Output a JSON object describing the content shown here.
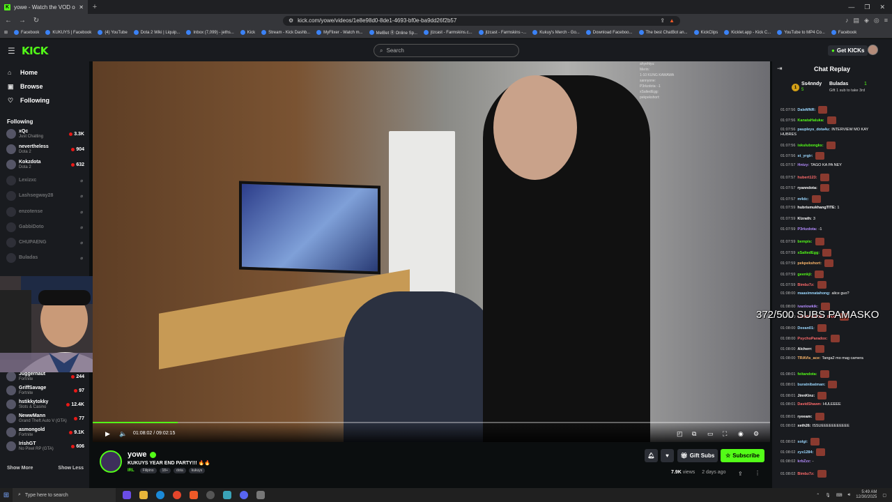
{
  "browser": {
    "tab_title": "yowe - Watch the VOD on Kick",
    "url": "kick.com/yowe/videos/1e8e98d0-8de1-4693-bf0e-ba9dd26f2b57",
    "bookmarks": [
      "Facebook",
      "KUKUYS | Facebook",
      "(4) YouTube",
      "Dota 2 Wiki | Liquip...",
      "Inbox (7,099) - jeths...",
      "Kick",
      "Stream - Kick Dashb...",
      "MyFlixer - Watch m...",
      "MelBet Ⓡ Online Sp...",
      "jtzcast - Farmskins.c...",
      "jtzcast - Farmskins -...",
      "Kukuy's Merch - Go...",
      "Download Faceboo...",
      "The best ChatBot an...",
      "KickClips",
      "Kicklet.app - Kick C...",
      "YouTube to MP4 Co...",
      "Facebook"
    ]
  },
  "header": {
    "logo": "KICK",
    "search_placeholder": "Search",
    "get_kicks": "Get KICKs"
  },
  "sidebar": {
    "nav": [
      {
        "label": "Home",
        "icon": "home-icon"
      },
      {
        "label": "Browse",
        "icon": "browse-icon"
      },
      {
        "label": "Following",
        "icon": "heart-icon"
      }
    ],
    "following_heading": "Following",
    "channels": [
      {
        "name": "xQc",
        "category": "Just Chatting",
        "viewers": "3.3K",
        "live": true
      },
      {
        "name": "nevertheless",
        "category": "Dota 2",
        "viewers": "904",
        "live": true
      },
      {
        "name": "Kokzdota",
        "category": "Dota 2",
        "viewers": "632",
        "live": true
      },
      {
        "name": "Lexizxc",
        "category": "",
        "viewers": "",
        "live": false
      },
      {
        "name": "Lashsegway28",
        "category": "",
        "viewers": "",
        "live": false
      },
      {
        "name": "enzotense",
        "category": "",
        "viewers": "",
        "live": false
      },
      {
        "name": "GabbiDoto",
        "category": "",
        "viewers": "",
        "live": false
      },
      {
        "name": "CHUPAENG",
        "category": "",
        "viewers": "",
        "live": false
      },
      {
        "name": "Buladas",
        "category": "",
        "viewers": "",
        "live": false
      },
      {
        "name": "Juggernaut",
        "category": "Fortnite",
        "viewers": "244",
        "live": true
      },
      {
        "name": "GriffSavage",
        "category": "Fortnite",
        "viewers": "97",
        "live": true
      },
      {
        "name": "hstikkytokky",
        "category": "Slots & Casino",
        "viewers": "12.4K",
        "live": true
      },
      {
        "name": "NewwMann",
        "category": "Grand Theft Auto V (GTA)",
        "viewers": "77",
        "live": true
      },
      {
        "name": "asmongold",
        "category": "Fortnite",
        "viewers": "9.1K",
        "live": true
      },
      {
        "name": "IrishGT",
        "category": "No Pixel RP (GTA)",
        "viewers": "606",
        "live": true
      }
    ],
    "show_more": "Show More",
    "show_less": "Show Less"
  },
  "video": {
    "time": "01:08:02 / 09:02:15",
    "progress": 0.126,
    "chat_overlay": [
      "ahyehtyu:",
      "Merin:",
      "1-10 KUNG KAWAWA",
      "sannyone:",
      "P3rkzdota: -1",
      "xSaltedEgg:",
      "pekpekshort:"
    ]
  },
  "stream": {
    "channel": "yowe",
    "title": "KUKUYS YEAR END PARTY!!! 🔥🔥",
    "category": "IRL",
    "tags": [
      "Filipino",
      "18+",
      "dota",
      "kukuys"
    ],
    "views": "7.9K",
    "views_label": "views",
    "age": "2 days ago",
    "gift_subs": "Gift Subs",
    "subscribe": "Subscribe"
  },
  "chat": {
    "title": "Chat Replay",
    "pinned_user": "Ss4nndy",
    "pinned_count": "5",
    "pinned_user2": "Buladas",
    "pinned_count2": "1",
    "pinned_msg": "Gift 1 sub to take 3rd",
    "overlay_text": "372/500 SUBS PAMASKO",
    "messages": [
      {
        "ts": "01:07:56",
        "user": "DaleMNR:",
        "text": "",
        "color": "#9bd8ff",
        "emote": true
      },
      {
        "ts": "01:07:56",
        "user": "KanataHaluka:",
        "text": "",
        "color": "#53fc18",
        "emote": true
      },
      {
        "ts": "01:07:56",
        "user": "paupleys_dota4u:",
        "text": "INTERVIEW MO KAY HUBRES",
        "color": "#9bd8ff",
        "emote": false
      },
      {
        "ts": "01:07:56",
        "user": "iskulubongks:",
        "text": "",
        "color": "#53fc18",
        "emote": true
      },
      {
        "ts": "01:07:56",
        "user": "st_yrgir:",
        "text": "",
        "color": "#9bd8ff",
        "emote": true
      },
      {
        "ts": "01:07:57",
        "user": "Hntzy:",
        "text": "TAGO KA PA NEY",
        "color": "#b48cff",
        "emote": false
      },
      {
        "ts": "01:07:57",
        "user": "hubert123:",
        "text": "",
        "color": "#ff6b6b",
        "emote": true
      },
      {
        "ts": "01:07:57",
        "user": "ryanndota:",
        "text": "",
        "color": "#fff",
        "emote": true
      },
      {
        "ts": "01:07:57",
        "user": "m4dc:",
        "text": "",
        "color": "#9bd8ff",
        "emote": true
      },
      {
        "ts": "01:07:59",
        "user": "hubrismukhangTITE:",
        "text": "1",
        "color": "#fff",
        "emote": false
      },
      {
        "ts": "01:07:59",
        "user": "Klzrath:",
        "text": "3",
        "color": "#fff",
        "emote": false
      },
      {
        "ts": "01:07:59",
        "user": "P3rkzdota:",
        "text": "-1",
        "color": "#b48cff",
        "emote": false
      },
      {
        "ts": "01:07:59",
        "user": "bempis:",
        "text": "",
        "color": "#53fc18",
        "emote": true
      },
      {
        "ts": "01:07:59",
        "user": "xSaltedEgg:",
        "text": "",
        "color": "#53fc18",
        "emote": true
      },
      {
        "ts": "01:07:59",
        "user": "pekpekshort:",
        "text": "",
        "color": "#ffb86b",
        "emote": true
      },
      {
        "ts": "01:07:59",
        "user": "geenkji:",
        "text": "",
        "color": "#53fc18",
        "emote": true
      },
      {
        "ts": "01:07:59",
        "user": "Bimbz7z:",
        "text": "",
        "color": "#ff6b6b",
        "emote": true
      },
      {
        "ts": "01:08:00",
        "user": "maasimnatahong:",
        "text": "alice guo?",
        "color": "#9bd8ff",
        "emote": false
      },
      {
        "ts": "01:08:00",
        "user": "ivanlowkik:",
        "text": "",
        "color": "#b48cff",
        "emote": true
      },
      {
        "ts": "01:08:00",
        "user": "LAMBiiniKOKZ_0000:",
        "text": "",
        "color": "#ff6b6b",
        "emote": true
      },
      {
        "ts": "01:08:00",
        "user": "Deean01:",
        "text": "",
        "color": "#9bd8ff",
        "emote": true
      },
      {
        "ts": "01:08:00",
        "user": "PsychoParadox:",
        "text": "",
        "color": "#ff6b6b",
        "emote": true
      },
      {
        "ts": "01:08:00",
        "user": "Alcherr:",
        "text": "",
        "color": "#fff",
        "emote": true
      },
      {
        "ts": "01:08:00",
        "user": "TRAVis_ace:",
        "text": "Tanga2 mo mag camera",
        "color": "#ffb86b",
        "emote": false
      },
      {
        "ts": "01:08:01",
        "user": "feitandota:",
        "text": "",
        "color": "#53fc18",
        "emote": true
      },
      {
        "ts": "01:08:01",
        "user": "buratnibatman:",
        "text": "",
        "color": "#9bd8ff",
        "emote": true
      },
      {
        "ts": "01:08:01",
        "user": "JinnKinz:",
        "text": "",
        "color": "#fff",
        "emote": true
      },
      {
        "ts": "01:08:01",
        "user": "DavidShawn:",
        "text": "HULEEEE",
        "color": "#ff6b6b",
        "emote": false
      },
      {
        "ts": "01:08:01",
        "user": "ryeeam:",
        "text": "",
        "color": "#fff",
        "emote": true
      },
      {
        "ts": "01:08:02",
        "user": "xeth26:",
        "text": "ISSUEEEEEEEEEEE",
        "color": "#fff",
        "emote": false
      },
      {
        "ts": "01:08:02",
        "user": "solgi:",
        "text": "",
        "color": "#9bd8ff",
        "emote": true
      },
      {
        "ts": "01:08:02",
        "user": "zyx1284:",
        "text": "",
        "color": "#9bd8ff",
        "emote": true
      },
      {
        "ts": "01:08:02",
        "user": "krbZzz:",
        "text": "-",
        "color": "#b48cff",
        "emote": false
      },
      {
        "ts": "01:08:02",
        "user": "Bimbz7z:",
        "text": "",
        "color": "#ff6b6b",
        "emote": true
      }
    ]
  },
  "taskbar": {
    "search_placeholder": "Type here to search",
    "time": "5:49 AM",
    "date": "12/30/2025"
  }
}
